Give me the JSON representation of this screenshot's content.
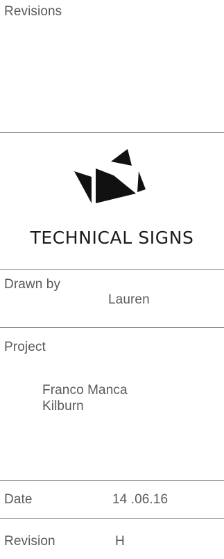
{
  "revisions": {
    "label": "Revisions"
  },
  "company": {
    "name": "TECHNICAL SIGNS",
    "logo_icon": "ts-monogram-logo-icon"
  },
  "drawn_by": {
    "label": "Drawn by",
    "value": "Lauren"
  },
  "project": {
    "label": "Project",
    "lines": [
      "Franco Manca",
      "Kilburn"
    ]
  },
  "date": {
    "label": "Date",
    "value": "14 .06.16"
  },
  "revision": {
    "label": "Revision",
    "value": "H"
  },
  "colors": {
    "text": "#5a5a5a",
    "rule": "#8a8a8a",
    "logo": "#111111"
  }
}
